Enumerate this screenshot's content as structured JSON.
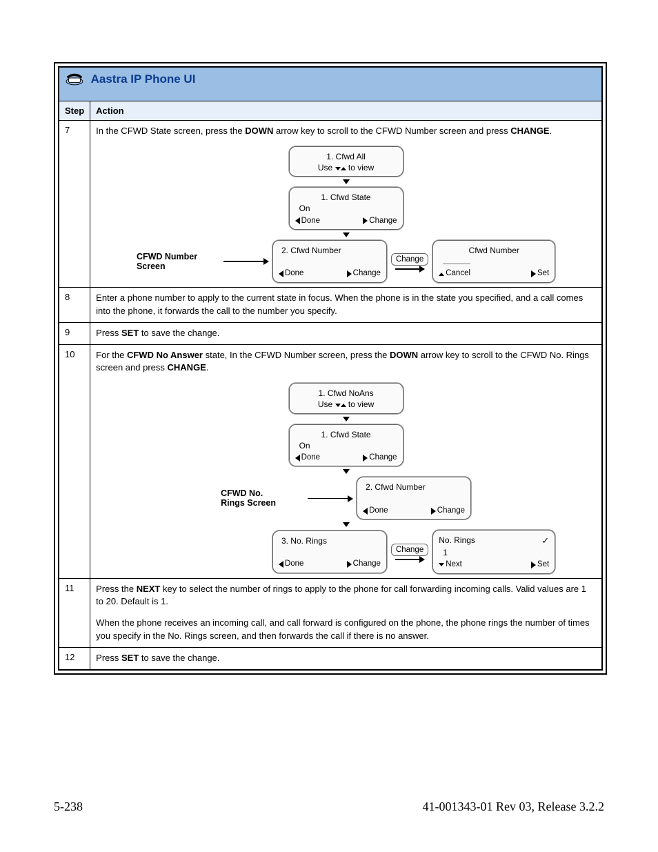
{
  "title": "Aastra IP Phone UI",
  "columns": {
    "step": "Step",
    "action": "Action"
  },
  "footer": {
    "left": "5-238",
    "right": "41-001343-01 Rev 03, Release 3.2.2"
  },
  "labels": {
    "cfwd_number_screen_line1": "CFWD Number",
    "cfwd_number_screen_line2": "Screen",
    "cfwd_rings_screen_line1": "CFWD No.",
    "cfwd_rings_screen_line2": "Rings Screen",
    "change_btn": "Change"
  },
  "steps": {
    "s7": {
      "num": "7",
      "text_parts": [
        "In the CFWD State screen, press the ",
        "DOWN",
        " arrow key to scroll to the CFWD Number screen and press ",
        "CHANGE",
        "."
      ],
      "lcd_all_title": "1. Cfwd All",
      "lcd_all_sub_pre": "Use ",
      "lcd_all_sub_post": " to view",
      "lcd_state_title": "1. Cfwd State",
      "lcd_state_sub": "On",
      "lcd_num_title": "2. Cfwd Number",
      "done": "Done",
      "change": "Change",
      "cancel": "Cancel",
      "set": "Set",
      "lcd_edit_title": "Cfwd Number"
    },
    "s8": {
      "num": "8",
      "text": "Enter a phone number to apply to the current state in focus. When the phone is in the state you specified, and a call comes into the phone, it forwards the call to the number you specify."
    },
    "s9": {
      "num": "9",
      "text_parts": [
        "Press ",
        "SET",
        " to save the change."
      ]
    },
    "s10": {
      "num": "10",
      "text_parts": [
        "For the ",
        "CFWD No Answer",
        " state, In the CFWD Number screen, press the ",
        "DOWN",
        " arrow key to scroll to the CFWD No. Rings screen and press ",
        "CHANGE",
        "."
      ],
      "lcd_noans_title": "1. Cfwd NoAns",
      "lcd_noans_sub_pre": "Use ",
      "lcd_noans_sub_post": " to view",
      "lcd_state_title": "1. Cfwd State",
      "lcd_state_sub": "On",
      "lcd_num_title": "2. Cfwd Number",
      "lcd_rings_title": "3. No. Rings",
      "done": "Done",
      "change": "Change",
      "next": "Next",
      "set": "Set",
      "lcd_edit_title": "No. Rings",
      "lcd_edit_value": "1"
    },
    "s11": {
      "num": "11",
      "para1_parts": [
        "Press the ",
        "NEXT",
        " key to select the number of rings to apply to the phone for call forwarding incoming calls. Valid values are 1 to 20. Default is 1."
      ],
      "para2": "When the phone receives an incoming call, and call forward is configured on the phone, the phone rings the number of times you specify in the No. Rings screen, and then forwards the call if there is no answer."
    },
    "s12": {
      "num": "12",
      "text_parts": [
        "Press ",
        "SET",
        " to save the change."
      ]
    }
  }
}
